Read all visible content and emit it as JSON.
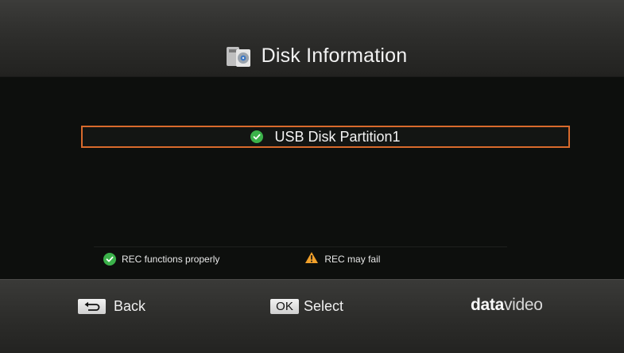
{
  "header": {
    "title": "Disk Information",
    "icon": "usb-disk-icon"
  },
  "partitions": [
    {
      "label": "USB Disk Partition1",
      "status": "ok",
      "status_icon": "check-circle-icon",
      "selected": true
    }
  ],
  "legend": {
    "ok_label": "REC functions properly",
    "ok_icon": "check-circle-icon",
    "warn_label": "REC may fail",
    "warn_icon": "warning-triangle-icon"
  },
  "footer": {
    "back_label": "Back",
    "back_icon": "return-arrow-icon",
    "ok_key": "OK",
    "select_label": "Select",
    "brand_bold": "data",
    "brand_light": "video"
  },
  "colors": {
    "accent_border": "#d86a2c",
    "ok_green": "#3bb24a",
    "warn_orange": "#f0a02a"
  }
}
